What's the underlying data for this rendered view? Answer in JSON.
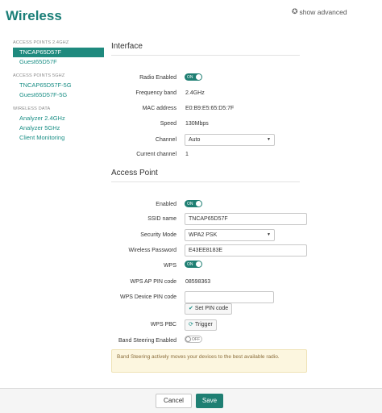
{
  "header": {
    "title": "Wireless",
    "show_advanced": "show advanced",
    "show_advanced_icon": "gear-icon"
  },
  "sidebar": {
    "groups": [
      {
        "header": "ACCESS POINTS 2.4GHZ",
        "items": [
          {
            "label": "TNCAP65D57F",
            "active": true
          },
          {
            "label": "Guest65D57F"
          }
        ]
      },
      {
        "header": "ACCESS POINTS 5GHZ",
        "items": [
          {
            "label": "TNCAP65D57F-5G"
          },
          {
            "label": "Guest65D57F-5G"
          }
        ]
      },
      {
        "header": "WIRELESS DATA",
        "items": [
          {
            "label": "Analyzer 2.4GHz"
          },
          {
            "label": "Analyzer 5GHz"
          },
          {
            "label": "Client Monitoring"
          }
        ]
      }
    ]
  },
  "interface": {
    "title": "Interface",
    "radio_enabled": {
      "label": "Radio Enabled",
      "state": "ON"
    },
    "frequency_band": {
      "label": "Frequency band",
      "value": "2.4GHz"
    },
    "mac_address": {
      "label": "MAC address",
      "value": "E0:B9:E5:65:D5:7F"
    },
    "speed": {
      "label": "Speed",
      "value": "130Mbps"
    },
    "channel": {
      "label": "Channel",
      "value": "Auto"
    },
    "current_channel": {
      "label": "Current channel",
      "value": "1"
    }
  },
  "access_point": {
    "title": "Access Point",
    "enabled": {
      "label": "Enabled",
      "state": "ON"
    },
    "ssid": {
      "label": "SSID name",
      "value": "TNCAP65D57F"
    },
    "security": {
      "label": "Security Mode",
      "value": "WPA2 PSK"
    },
    "password": {
      "label": "Wireless Password",
      "value": "E43EE8183E"
    },
    "wps": {
      "label": "WPS",
      "state": "ON"
    },
    "wps_ap_pin": {
      "label": "WPS AP PIN code",
      "value": "08598363"
    },
    "wps_device_pin": {
      "label": "WPS Device PIN code",
      "value": "",
      "button": "Set PIN code"
    },
    "wps_pbc": {
      "label": "WPS PBC",
      "button": "Trigger"
    },
    "band_steering": {
      "label": "Band Steering Enabled",
      "state": "OFF"
    },
    "notice": "Band Steering actively moves your devices to the best available radio."
  },
  "footer": {
    "cancel": "Cancel",
    "save": "Save"
  },
  "colors": {
    "accent": "#1f7f73",
    "title": "#1b7f78",
    "notice_bg": "#fcf6df"
  }
}
